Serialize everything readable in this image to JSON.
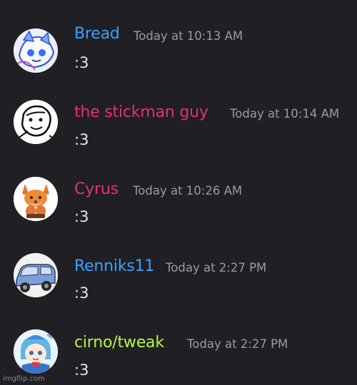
{
  "messages": [
    {
      "username": "Bread",
      "timestamp": "Today at 10:13 AM",
      "text": ":3",
      "username_color": "#3ea0ff",
      "avatar_icon": "bread-avatar-icon"
    },
    {
      "username": "the stickman guy",
      "timestamp": "Today at 10:14 AM",
      "text": ":3",
      "username_color": "#e4336b",
      "avatar_icon": "stickman-avatar-icon"
    },
    {
      "username": "Cyrus",
      "timestamp": "Today at 10:26 AM",
      "text": ":3",
      "username_color": "#e4336b",
      "avatar_icon": "fox-avatar-icon"
    },
    {
      "username": "Renniks11",
      "timestamp": "Today at 2:27 PM",
      "text": ":3",
      "username_color": "#3ea0ff",
      "avatar_icon": "car-avatar-icon"
    },
    {
      "username": "cirno/tweak",
      "timestamp": "Today at 2:27 PM",
      "text": ":3",
      "username_color": "#b7f54a",
      "avatar_icon": "cirno-avatar-icon"
    }
  ],
  "watermark": "imgflip.com"
}
